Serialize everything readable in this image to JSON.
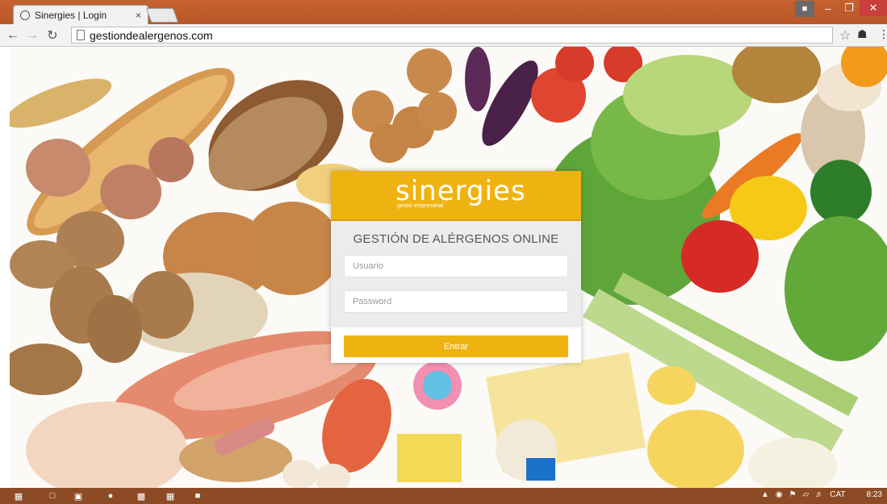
{
  "browser": {
    "tab_title": "Sinergies | Login",
    "tab_close": "×",
    "url": "gestiondealergenos.com",
    "window_buttons": {
      "minimize": "–",
      "maximize": "❐",
      "close": "✕"
    }
  },
  "login": {
    "logo_text": "sinergies",
    "logo_tagline": "gestió empresarial",
    "title": "GESTIÓN DE ALÉRGENOS ONLINE",
    "username_placeholder": "Usuario",
    "password_placeholder": "Password",
    "submit_label": "Entrar"
  },
  "taskbar": {
    "language": "CAT",
    "time": "8:23"
  },
  "colors": {
    "brand_yellow": "#efb311",
    "titlebar": "#c6622f",
    "taskbar": "#8c4a25"
  }
}
